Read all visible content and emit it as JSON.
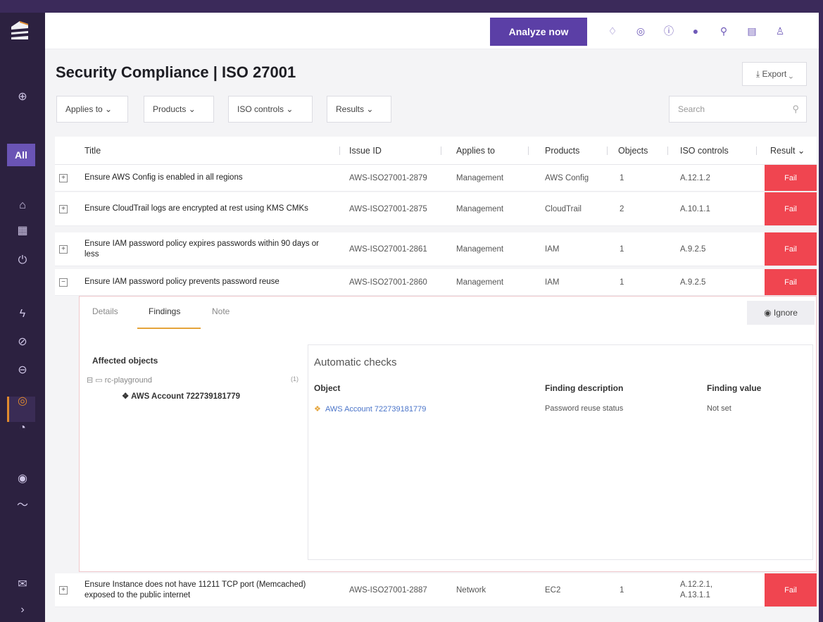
{
  "sidebar": {
    "categories": [
      "",
      "",
      "",
      "",
      ""
    ],
    "all_label": "All"
  },
  "topbar": {
    "analyze_label": "Analyze now"
  },
  "page": {
    "title": "Security Compliance | ISO 27001",
    "export_label": "Export"
  },
  "filters": {
    "applies_to": "Applies to",
    "products": "Products",
    "iso_controls": "ISO controls",
    "results": "Results",
    "search_placeholder": "Search"
  },
  "table": {
    "headers": [
      "Title",
      "Issue ID",
      "Applies to",
      "Products",
      "Objects",
      "ISO controls",
      "Result"
    ],
    "rows": [
      {
        "title": "Ensure AWS Config is enabled in all regions",
        "issue_id": "AWS-ISO27001-2879",
        "applies_to": "Management",
        "product": "AWS Config",
        "objects": "1",
        "iso": "A.12.1.2",
        "result": "Fail"
      },
      {
        "title": "Ensure CloudTrail logs are encrypted at rest using KMS CMKs",
        "issue_id": "AWS-ISO27001-2875",
        "applies_to": "Management",
        "product": "CloudTrail",
        "objects": "2",
        "iso": "A.10.1.1",
        "result": "Fail"
      },
      {
        "title": "Ensure IAM password policy expires passwords within 90 days or less",
        "issue_id": "AWS-ISO27001-2861",
        "applies_to": "Management",
        "product": "IAM",
        "objects": "1",
        "iso": "A.9.2.5",
        "result": "Fail"
      },
      {
        "title": "Ensure IAM password policy prevents password reuse",
        "issue_id": "AWS-ISO27001-2860",
        "applies_to": "Management",
        "product": "IAM",
        "objects": "1",
        "iso": "A.9.2.5",
        "result": "Fail"
      },
      {
        "title": "Ensure Instance does not have 11211 TCP port (Memcached) exposed to the public internet",
        "issue_id": "AWS-ISO27001-2887",
        "applies_to": "Network",
        "product": "EC2",
        "objects": "1",
        "iso": "A.12.2.1, A.13.1.1",
        "result": "Fail"
      }
    ]
  },
  "details": {
    "tabs": [
      "Details",
      "Findings",
      "Note"
    ],
    "ignore_label": "Ignore",
    "affected_title": "Affected objects",
    "tree_root": "rc-playground",
    "tree_count": "(1)",
    "tree_leaf": "AWS Account 722739181779",
    "auto_title": "Automatic checks",
    "auto_headers": [
      "Object",
      "Finding description",
      "Finding value"
    ],
    "auto_row": {
      "object": "AWS Account 722739181779",
      "description": "Password reuse status",
      "value": "Not set"
    }
  }
}
